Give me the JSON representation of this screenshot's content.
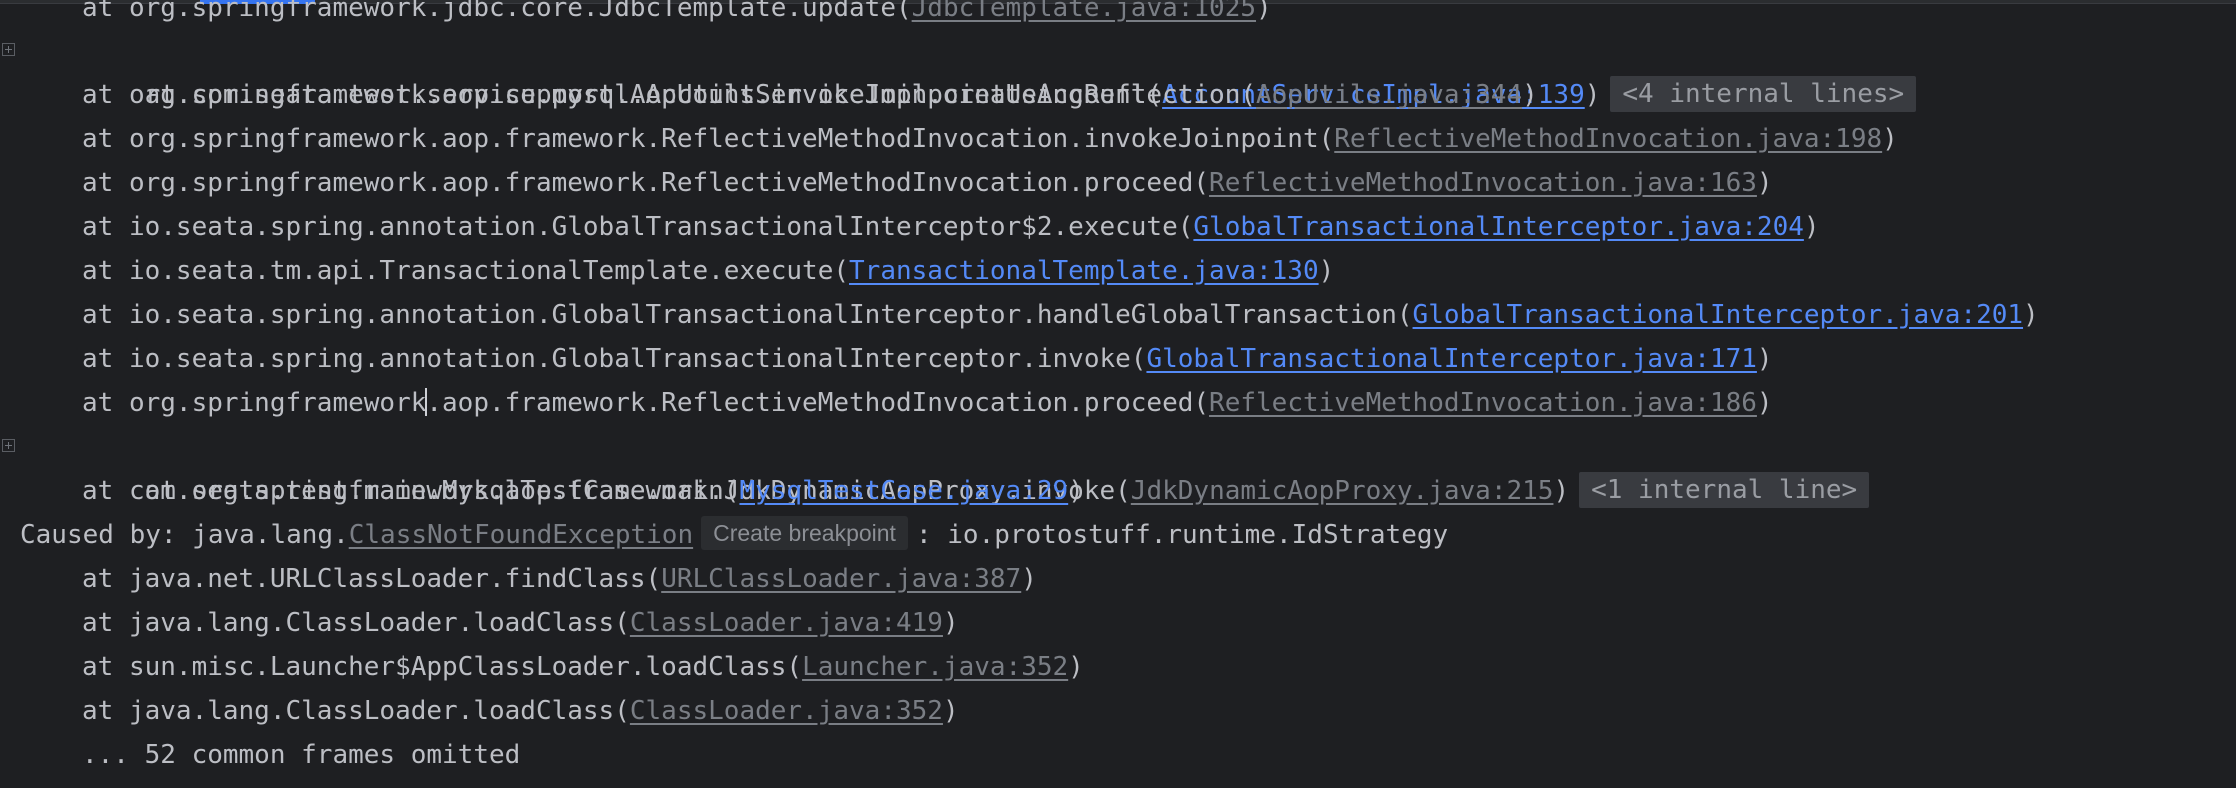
{
  "partial_top_line": {
    "prefix": "at org.springframework.jdbc.core.JdbcTemplate.update(",
    "link": "JdbcTemplate.java:1025",
    "suffix": ")"
  },
  "frames_a": [
    {
      "prefix": "at com.seata.test.service.mysql.AccountServiceImpl.createAccount(",
      "link": "AccountServiceImpl.java:139",
      "suffix": ")",
      "pill": "<4 internal lines>"
    },
    {
      "prefix": "at org.springframework.aop.support.AopUtils.invokeJoinpointUsingReflection(",
      "link": "AopUtils.java:344",
      "suffix": ")"
    },
    {
      "prefix": "at org.springframework.aop.framework.ReflectiveMethodInvocation.invokeJoinpoint(",
      "link": "ReflectiveMethodInvocation.java:198",
      "suffix": ")"
    },
    {
      "prefix": "at org.springframework.aop.framework.ReflectiveMethodInvocation.proceed(",
      "link": "ReflectiveMethodInvocation.java:163",
      "suffix": ")"
    },
    {
      "prefix": "at io.seata.spring.annotation.GlobalTransactionalInterceptor$2.execute(",
      "link": "GlobalTransactionalInterceptor.java:204",
      "suffix": ")"
    },
    {
      "prefix": "at io.seata.tm.api.TransactionalTemplate.execute(",
      "link": "TransactionalTemplate.java:130",
      "suffix": ")"
    },
    {
      "prefix": "at io.seata.spring.annotation.GlobalTransactionalInterceptor.handleGlobalTransaction(",
      "link": "GlobalTransactionalInterceptor.java:201",
      "suffix": ")"
    },
    {
      "prefix": "at io.seata.spring.annotation.GlobalTransactionalInterceptor.invoke(",
      "link": "GlobalTransactionalInterceptor.java:171",
      "suffix": ")"
    }
  ],
  "frame_with_caret": {
    "before_caret": "at org.springframework",
    "after_caret": ".aop.framework.ReflectiveMethodInvocation.proceed(",
    "link": "ReflectiveMethodInvocation.java:186",
    "suffix": ")"
  },
  "frames_b": [
    {
      "prefix": "at org.springframework.aop.framework.JdkDynamicAopProxy.invoke(",
      "link": "JdkDynamicAopProxy.java:215",
      "suffix": ")",
      "pill": "<1 internal line>"
    },
    {
      "prefix": "at com.seata.test.main.MysqlTestCase.main(",
      "link": "MysqlTestCase.java:29",
      "suffix": ")"
    }
  ],
  "caused_by": {
    "prefix": "Caused by: java.lang.",
    "exception_link": "ClassNotFoundException",
    "breakpoint_button": "Create breakpoint",
    "message": ": io.protostuff.runtime.IdStrategy"
  },
  "frames_c": [
    {
      "prefix": "at java.net.URLClassLoader.findClass(",
      "link": "URLClassLoader.java:387",
      "suffix": ")"
    },
    {
      "prefix": "at java.lang.ClassLoader.loadClass(",
      "link": "ClassLoader.java:419",
      "suffix": ")"
    },
    {
      "prefix": "at sun.misc.Launcher$AppClassLoader.loadClass(",
      "link": "Launcher.java:352",
      "suffix": ")"
    },
    {
      "prefix": "at java.lang.ClassLoader.loadClass(",
      "link": "ClassLoader.java:352",
      "suffix": ")"
    }
  ],
  "omitted": "... 52 common frames omitted",
  "colors": {
    "background": "#1e1f22",
    "text": "#bcbec4",
    "project_link": "#548af7",
    "library_link": "#7a7e85",
    "pill_background": "#393b40"
  }
}
